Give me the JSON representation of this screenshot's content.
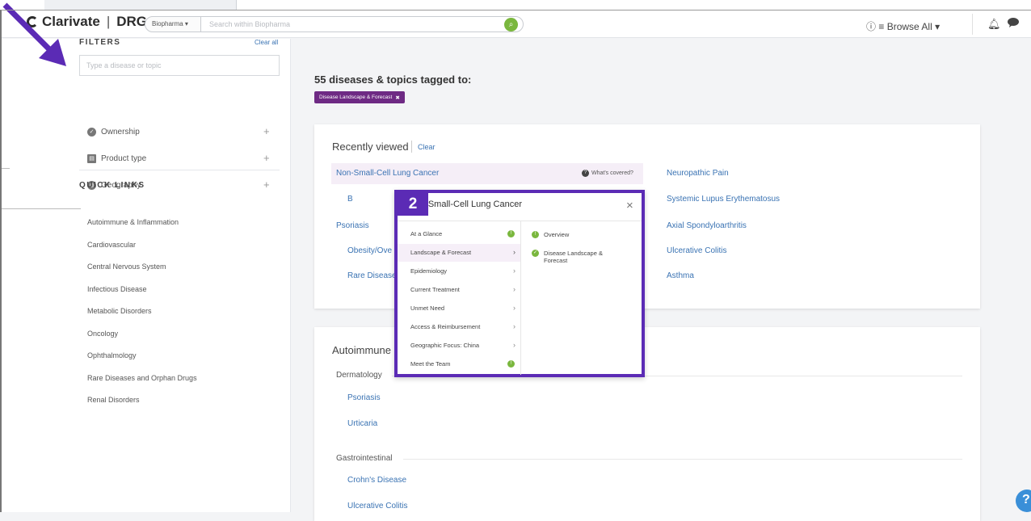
{
  "header": {
    "brand": "Clarivate",
    "brand_suffix": "DRG",
    "scope_selector": "Biopharma",
    "search_placeholder": "Search within Biopharma",
    "browse_all": "Browse All"
  },
  "filters": {
    "title": "FILTERS",
    "clear_all": "Clear all",
    "input_placeholder": "Type a disease or topic",
    "facets": [
      "Ownership",
      "Product type",
      "Geography"
    ]
  },
  "quick_links": {
    "title": "QUICK LINKS",
    "items": [
      "Autoimmune & Inflammation",
      "Cardiovascular",
      "Central Nervous System",
      "Infectious Disease",
      "Metabolic Disorders",
      "Oncology",
      "Ophthalmology",
      "Rare Diseases and Orphan Drugs",
      "Renal Disorders"
    ]
  },
  "results": {
    "title": "55 diseases & topics tagged to:",
    "tag": "Disease Landscape & Forecast"
  },
  "recently_viewed": {
    "title": "Recently viewed",
    "clear": "Clear",
    "whats_covered": "What's covered?",
    "left": [
      "Non-Small-Cell Lung Cancer",
      "B",
      "Psoriasis",
      "Obesity/Ove",
      "Rare Disease"
    ],
    "right": [
      "Neuropathic Pain",
      "Systemic Lupus Erythematosus",
      "Axial Spondyloarthritis",
      "Ulcerative Colitis",
      "Asthma"
    ]
  },
  "autoimmune": {
    "title": "Autoimmune &",
    "groups": [
      {
        "name": "Dermatology",
        "items": [
          "Psoriasis",
          "Urticaria"
        ]
      },
      {
        "name": "Gastrointestinal",
        "items": [
          "Crohn's Disease",
          "Ulcerative Colitis"
        ]
      }
    ]
  },
  "popup": {
    "badge": "2",
    "title": "Non-Small-Cell Lung Cancer",
    "close": "×",
    "menu": [
      "At a Glance",
      "Landscape & Forecast",
      "Epidemiology",
      "Current Treatment",
      "Unmet Need",
      "Access & Reimbursement",
      "Geographic Focus: China",
      "Meet the Team"
    ],
    "sub": [
      "Overview",
      "Disease Landscape & Forecast"
    ]
  },
  "help": "?",
  "colors": {
    "accent": "#5b2bb5",
    "tag": "#6e2a84",
    "link": "#3a73b3",
    "green": "#7ab73e"
  }
}
